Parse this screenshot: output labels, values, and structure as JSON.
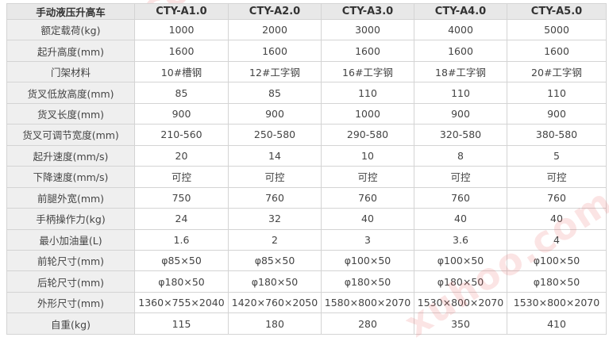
{
  "table": {
    "columns": [
      "手动液压升高车",
      "CTY-A1.0",
      "CTY-A2.0",
      "CTY-A3.0",
      "CTY-A4.0",
      "CTY-A5.0"
    ],
    "rows": [
      {
        "label": "额定载荷(kg)",
        "values": [
          "1000",
          "2000",
          "3000",
          "4000",
          "5000"
        ]
      },
      {
        "label": "起升高度(mm)",
        "values": [
          "1600",
          "1600",
          "1600",
          "1600",
          "1600"
        ]
      },
      {
        "label": "门架材料",
        "values": [
          "10#槽钢",
          "12#工字钢",
          "16#工字钢",
          "18#工字钢",
          "20#工字钢"
        ]
      },
      {
        "label": "货叉低放高度(mm)",
        "values": [
          "85",
          "85",
          "110",
          "110",
          "110"
        ]
      },
      {
        "label": "货叉长度(mm)",
        "values": [
          "900",
          "900",
          "1000",
          "900",
          "900"
        ]
      },
      {
        "label": "货叉可调节宽度(mm)",
        "values": [
          "210-560",
          "250-580",
          "290-580",
          "320-580",
          "380-580"
        ]
      },
      {
        "label": "起升速度(mm/s)",
        "values": [
          "20",
          "14",
          "10",
          "8",
          "5"
        ]
      },
      {
        "label": "下降速度(mm/s)",
        "values": [
          "可控",
          "可控",
          "可控",
          "可控",
          "可控"
        ]
      },
      {
        "label": "前腿外宽(mm)",
        "values": [
          "750",
          "760",
          "760",
          "760",
          "760"
        ]
      },
      {
        "label": "手柄操作力(kg)",
        "values": [
          "24",
          "32",
          "40",
          "40",
          "40"
        ]
      },
      {
        "label": "最小加油量(L)",
        "values": [
          "1.6",
          "2",
          "3",
          "3.6",
          "4"
        ]
      },
      {
        "label": "前轮尺寸(mm)",
        "values": [
          "φ85×50",
          "φ85×50",
          "φ100×50",
          "φ100×50",
          "φ100×50"
        ]
      },
      {
        "label": "后轮尺寸(mm)",
        "values": [
          "φ180×50",
          "φ180×50",
          "φ180×50",
          "φ180×50",
          "φ180×50"
        ]
      },
      {
        "label": "外形尺寸(mm)",
        "values": [
          "1360×755×2040",
          "1420×760×2050",
          "1580×800×2070",
          "1530×800×2070",
          "1530×800×2070"
        ]
      },
      {
        "label": "自重(kg)",
        "values": [
          "115",
          "180",
          "280",
          "350",
          "410"
        ]
      }
    ]
  },
  "watermark": "xuhoo.com",
  "colors": {
    "header_bg": "#e8e8e8",
    "label_bg": "#efefef",
    "border": "#d4d4d4",
    "text": "#444444",
    "watermark": "#e85a5a"
  }
}
